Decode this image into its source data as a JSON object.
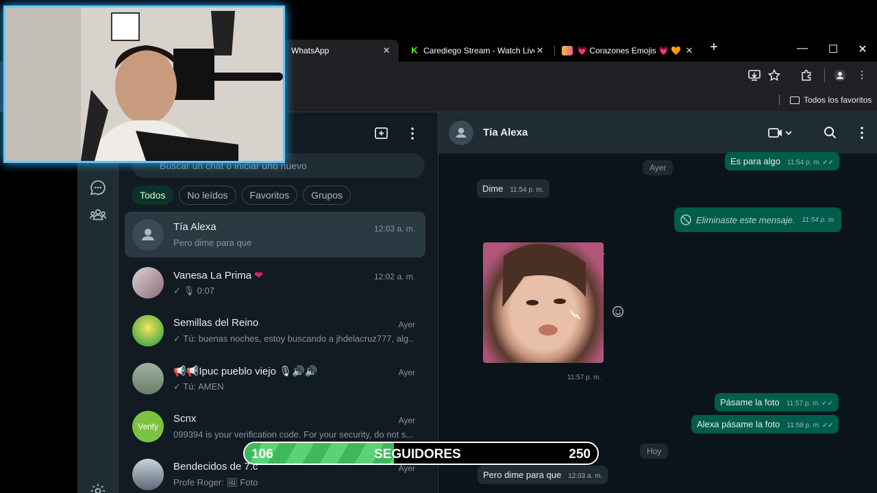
{
  "browser": {
    "tabs": [
      {
        "title": "WhatsApp",
        "active": true
      },
      {
        "title": "Carediego Stream - Watch Live",
        "active": false
      },
      {
        "title": "💗 Corazones Emojis 💗 🧡 💛",
        "active": false
      }
    ],
    "new_tab": "+",
    "window_controls": {
      "minimize": "—",
      "maximize": "☐",
      "close": "✕"
    },
    "bookmarks_folder": "Todos los favoritos"
  },
  "whatsapp": {
    "search_placeholder": "Buscar un chat o iniciar uno nuevo",
    "filters": [
      "Todos",
      "No leídos",
      "Favoritos",
      "Grupos"
    ],
    "chats": [
      {
        "name": "Tía Alexa",
        "time": "12:03 a. m.",
        "preview": "Pero dime para que",
        "selected": true
      },
      {
        "name": "Vanesa  La Prima",
        "name_suffix": "❤",
        "time": "12:02 a. m.",
        "preview": "✓ 🎙 0:07"
      },
      {
        "name": "Semillas del Reino",
        "time": "Ayer",
        "preview": "✓ Tú: buenas noches, estoy buscando a jhdelacruz777, alg..."
      },
      {
        "name": "📢📢Ipuc pueblo viejo 🎙🔊🔊",
        "time": "Ayer",
        "preview": "✓ Tú: AMEN"
      },
      {
        "name": "Scnx",
        "avatar_text": "Verify",
        "time": "Ayer",
        "preview": "099394 is your verification code. For your security, do not s..."
      },
      {
        "name": "Bendecidos de 7.c",
        "time": "Ayer",
        "preview": "Profe Roger: 🖼 Foto"
      }
    ],
    "conversation": {
      "contact": "Tía Alexa",
      "messages": [
        {
          "dir": "out",
          "text": "Es para algo",
          "time": "11:54 p. m.",
          "ticks": "✓✓"
        },
        {
          "type": "day",
          "text": "Ayer"
        },
        {
          "dir": "in",
          "text": "Dime",
          "time": "11:54 p. m."
        },
        {
          "dir": "out",
          "text": "Eliminaste este mensaje.",
          "time": "11:54 p. m.",
          "deleted": true
        },
        {
          "dir": "in",
          "type": "image",
          "time": "11:57 p. m."
        },
        {
          "dir": "out",
          "text": "Pásame la foto",
          "time": "11:57 p. m.",
          "ticks": "✓✓"
        },
        {
          "dir": "out",
          "text": "Alexa pásame la foto",
          "time": "11:59 p. m.",
          "ticks": "✓✓"
        },
        {
          "type": "day",
          "text": "Hoy"
        },
        {
          "dir": "in",
          "text": "Pero dime para que",
          "time": "12:03 a. m."
        }
      ]
    }
  },
  "overlay": {
    "followers_current": "106",
    "followers_label": "SEGUIDORES",
    "followers_goal": "250",
    "followers_progress": 0.424
  },
  "colors": {
    "whatsapp_green": "#005c4b",
    "panel": "#111b21",
    "header": "#202c33",
    "webcam_glow": "#5ecbff",
    "progress_green": "#3fb85a"
  }
}
